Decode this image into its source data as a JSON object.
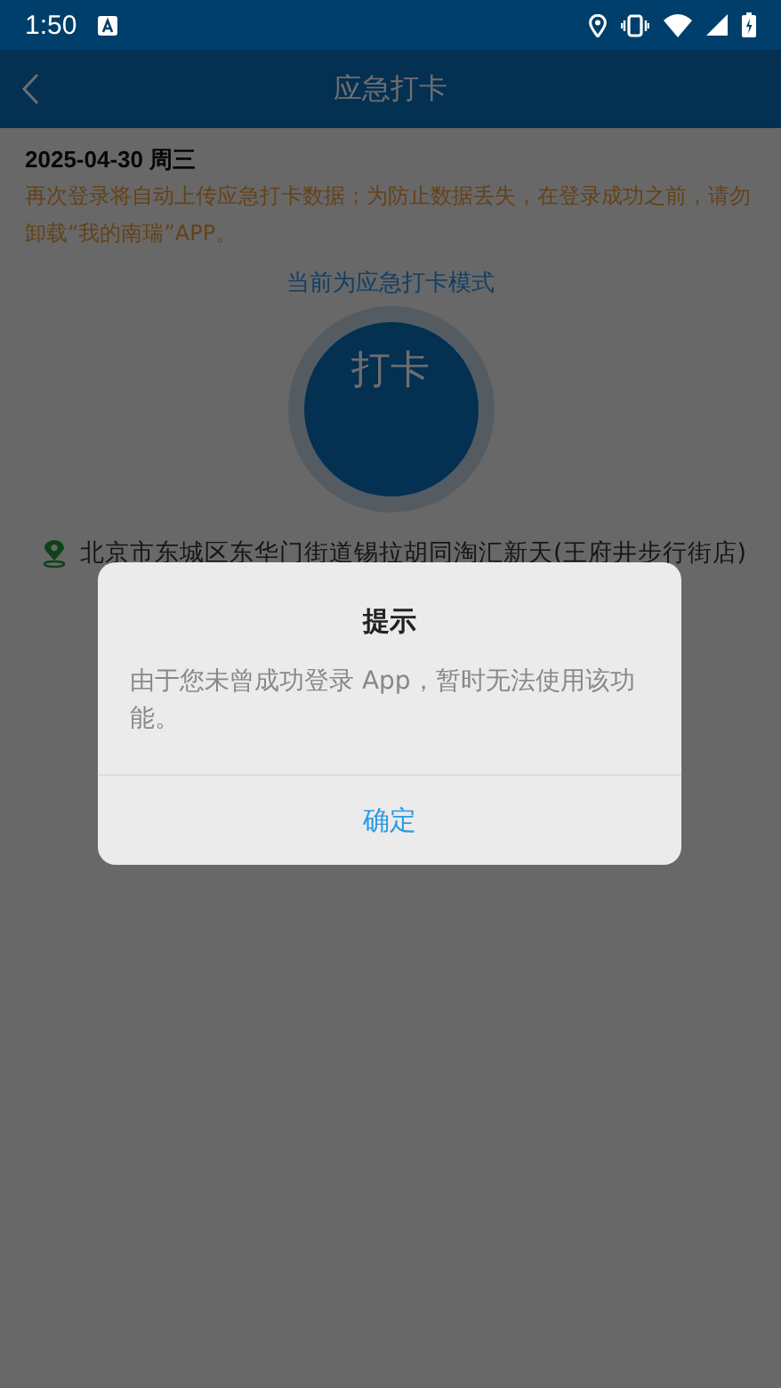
{
  "status_bar": {
    "time": "1:50"
  },
  "header": {
    "title": "应急打卡"
  },
  "date": "2025-04-30 周三",
  "notice": "再次登录将自动上传应急打卡数据；为防止数据丢失，在登录成功之前，请勿卸载“我的南瑞”APP。",
  "mode_label": "当前为应急打卡模式",
  "punch_button": {
    "label": "打卡"
  },
  "location": {
    "address": "北京市东城区东华门街道锡拉胡同淘汇新天(王府井步行街店)"
  },
  "dialog": {
    "title": "提示",
    "message": "由于您未曾成功登录 App，暂时无法使用该功能。",
    "buttons": [
      {
        "label": "确定"
      }
    ]
  }
}
